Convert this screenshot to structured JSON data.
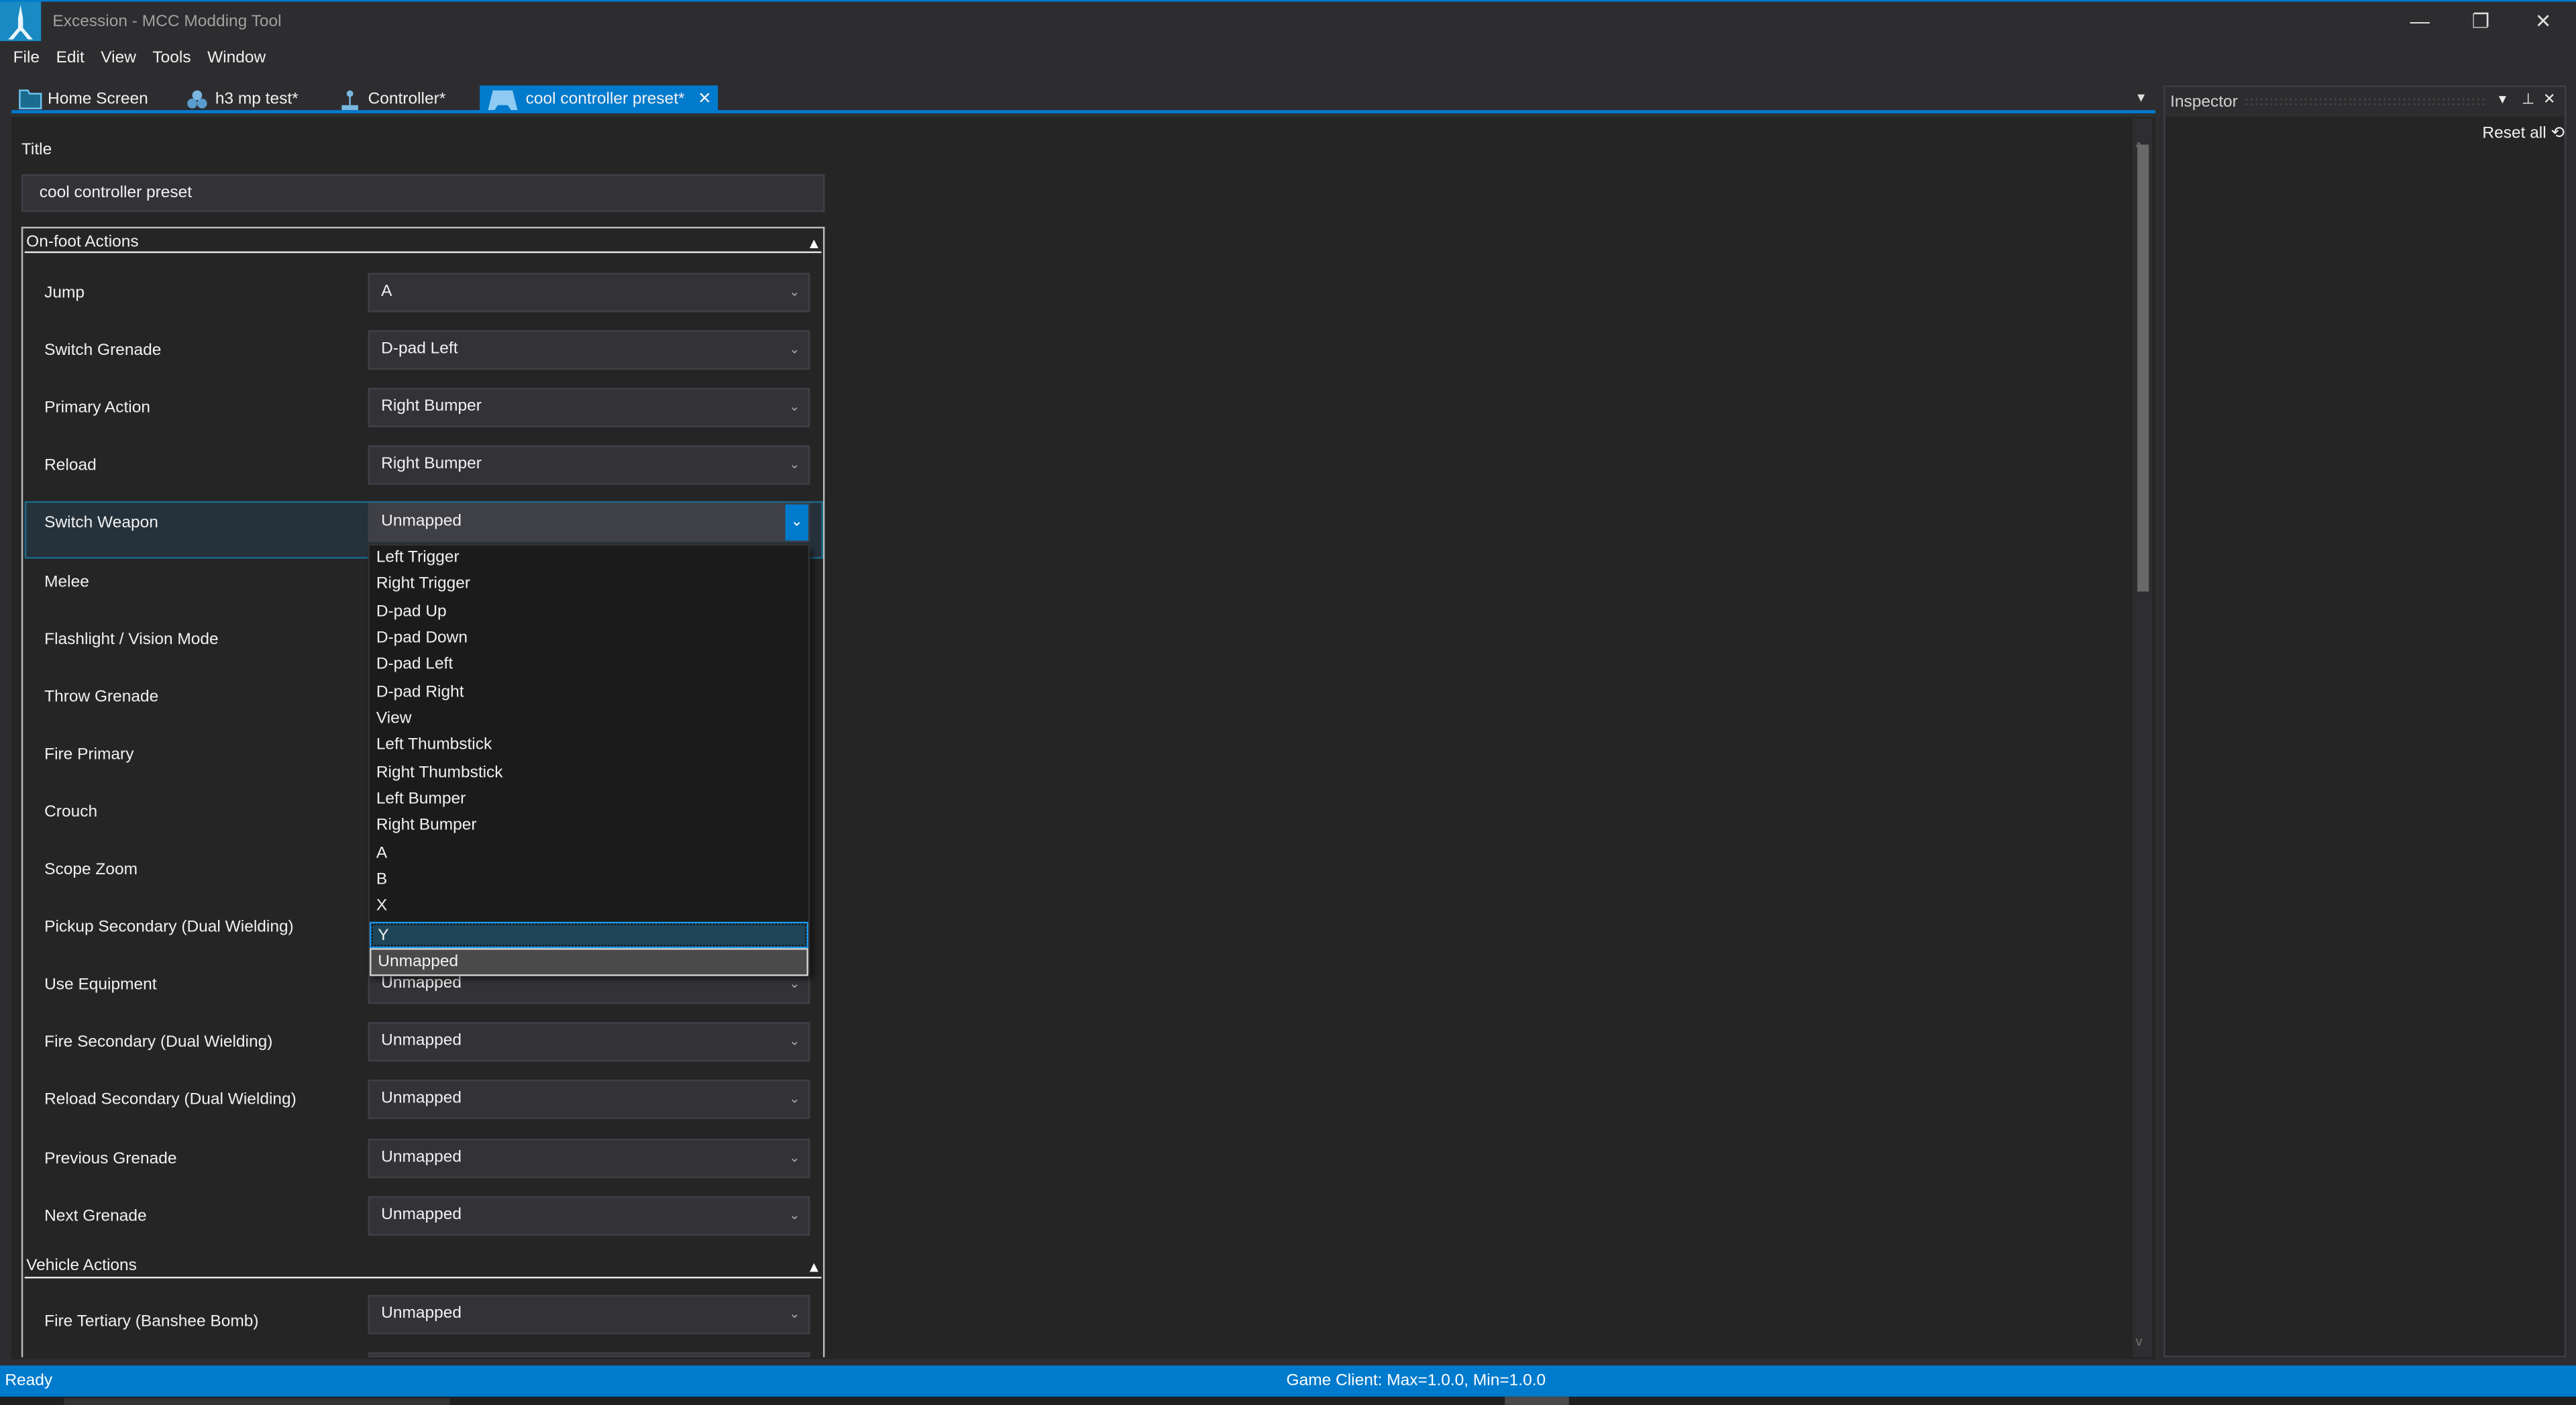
{
  "window": {
    "title": "Excession - MCC Modding Tool",
    "minimize": "—",
    "restore": "❐",
    "close": "✕"
  },
  "menu": [
    "File",
    "Edit",
    "View",
    "Tools",
    "Window"
  ],
  "tabs": [
    {
      "label": "Home Screen",
      "icon": "folder-icon"
    },
    {
      "label": "h3 mp test*",
      "icon": "cluster-icon"
    },
    {
      "label": "Controller*",
      "icon": "joystick-icon"
    },
    {
      "label": "cool controller preset*",
      "icon": "gamepad-icon",
      "active": true,
      "close": "✕"
    }
  ],
  "tab_menu": "▾",
  "editor": {
    "title_label": "Title",
    "title_value": "cool controller preset",
    "onfoot_header": "On-foot Actions",
    "vehicle_header": "Vehicle Actions",
    "collapse_glyph": "▲",
    "chevron": "⌄",
    "onfoot_rows": [
      {
        "label": "Jump",
        "value": "A"
      },
      {
        "label": "Switch Grenade",
        "value": "D-pad Left"
      },
      {
        "label": "Primary Action",
        "value": "Right Bumper"
      },
      {
        "label": "Reload",
        "value": "Right Bumper"
      },
      {
        "label": "Switch Weapon",
        "value": "Unmapped",
        "open": true
      },
      {
        "label": "Melee"
      },
      {
        "label": "Flashlight / Vision Mode"
      },
      {
        "label": "Throw Grenade"
      },
      {
        "label": "Fire Primary"
      },
      {
        "label": "Crouch"
      },
      {
        "label": "Scope Zoom"
      },
      {
        "label": "Pickup Secondary (Dual Wielding)"
      },
      {
        "label": "Use Equipment",
        "value": "Unmapped"
      },
      {
        "label": "Fire Secondary (Dual Wielding)",
        "value": "Unmapped"
      },
      {
        "label": "Reload Secondary (Dual Wielding)",
        "value": "Unmapped"
      },
      {
        "label": "Previous Grenade",
        "value": "Unmapped"
      },
      {
        "label": "Next Grenade",
        "value": "Unmapped"
      }
    ],
    "vehicle_rows": [
      {
        "label": "Fire Tertiary (Banshee Bomb)",
        "value": "Unmapped"
      }
    ],
    "dropdown_options": [
      "Left Trigger",
      "Right Trigger",
      "D-pad Up",
      "D-pad Down",
      "D-pad Left",
      "D-pad Right",
      "View",
      "Left Thumbstick",
      "Right Thumbstick",
      "Left Bumper",
      "Right Bumper",
      "A",
      "B",
      "X",
      "Y",
      "Unmapped"
    ],
    "dropdown_highlighted": "Y",
    "dropdown_selected": "Unmapped"
  },
  "inspector": {
    "title": "Inspector",
    "dropdown": "▾",
    "pin": "⊥",
    "close": "✕",
    "reset_all": "Reset all ⟲"
  },
  "status": {
    "left": "Ready",
    "center": "Game Client: Max=1.0.0, Min=1.0.0"
  },
  "colors": {
    "accent": "#007acc",
    "background": "#252526",
    "chrome": "#2d2d30"
  }
}
